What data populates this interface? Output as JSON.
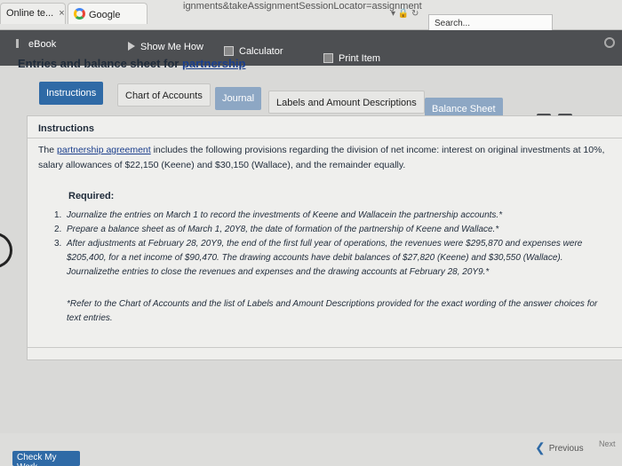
{
  "browser": {
    "tabs": [
      {
        "label": "Online te...",
        "close": "×"
      },
      {
        "label": "Google"
      }
    ],
    "url": "ignments&takeAssignmentSessionLocator=assignment",
    "search_placeholder": "Search..."
  },
  "toolbar": {
    "ebook": "eBook",
    "show_me_how": "Show Me How",
    "calculator": "Calculator",
    "print_item": "Print Item"
  },
  "page": {
    "title_text": "Entries and balance sheet for ",
    "title_link": "partnership"
  },
  "tabs": [
    "Instructions",
    "Chart of Accounts",
    "Journal",
    "Labels and Amount Descriptions",
    "Balance Sheet"
  ],
  "instructions": {
    "heading": "Instructions",
    "para_pre": "The ",
    "para_link": "partnership agreement",
    "para_post": " includes the following provisions regarding the division of net income: interest on original investments at 10%, salary allowances of $22,150 (Keene) and $30,150 (Wallace), and the remainder equally.",
    "required": "Required:",
    "items": [
      {
        "num": "1.",
        "text": "Journalize the entries on March 1 to record the investments of Keene and Wallacein the partnership accounts.*"
      },
      {
        "num": "2.",
        "text": "Prepare a balance sheet as of March 1, 20Y8, the date of formation of the partnership of Keene and Wallace.*"
      },
      {
        "num": "3.",
        "text": "After adjustments at February 28, 20Y9, the end of the first full year of operations, the revenues were $295,870 and expenses were $205,400, for a net income of $90,470. The drawing accounts have debit balances of $27,820 (Keene) and $30,550 (Wallace). Journalizethe entries to close the revenues and expenses and the drawing accounts at February 28, 20Y9.*"
      }
    ],
    "note": "*Refer to the Chart of Accounts and the list of Labels and Amount Descriptions provided for the exact wording of the answer choices for text entries."
  },
  "footer": {
    "check_my_work": "Check My Work",
    "previous": "Previous",
    "next": "Next"
  }
}
